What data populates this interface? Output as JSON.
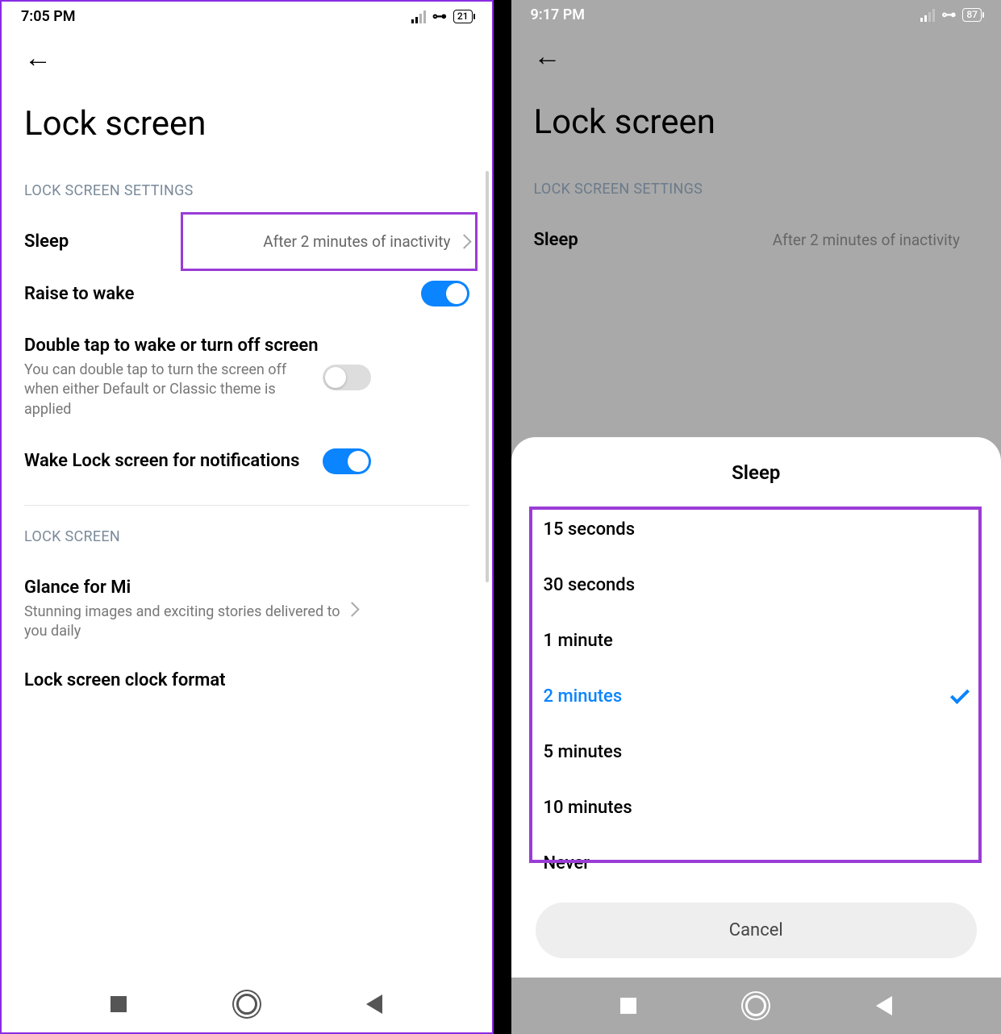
{
  "left": {
    "time": "7:05 PM",
    "battery": "21",
    "title": "Lock screen",
    "section1": "LOCK SCREEN SETTINGS",
    "sleep_label": "Sleep",
    "sleep_value": "After 2 minutes of inactivity",
    "raise_label": "Raise to wake",
    "dtap_title": "Double tap to wake or turn off screen",
    "dtap_sub": "You can double tap to turn the screen off when either Default or Classic theme is applied",
    "wake_notif": "Wake Lock screen for notifications",
    "section2": "LOCK SCREEN",
    "glance_title": "Glance for Mi",
    "glance_sub": "Stunning images and exciting stories delivered to you daily",
    "clock_format": "Lock screen clock format"
  },
  "right": {
    "time": "9:17 PM",
    "battery": "87",
    "title": "Lock screen",
    "section1": "LOCK SCREEN SETTINGS",
    "sleep_label": "Sleep",
    "sleep_value": "After 2 minutes of inactivity",
    "sheet_title": "Sleep",
    "options": [
      "15 seconds",
      "30 seconds",
      "1 minute",
      "2 minutes",
      "5 minutes",
      "10 minutes",
      "Never"
    ],
    "selected_index": 3,
    "cancel": "Cancel"
  }
}
